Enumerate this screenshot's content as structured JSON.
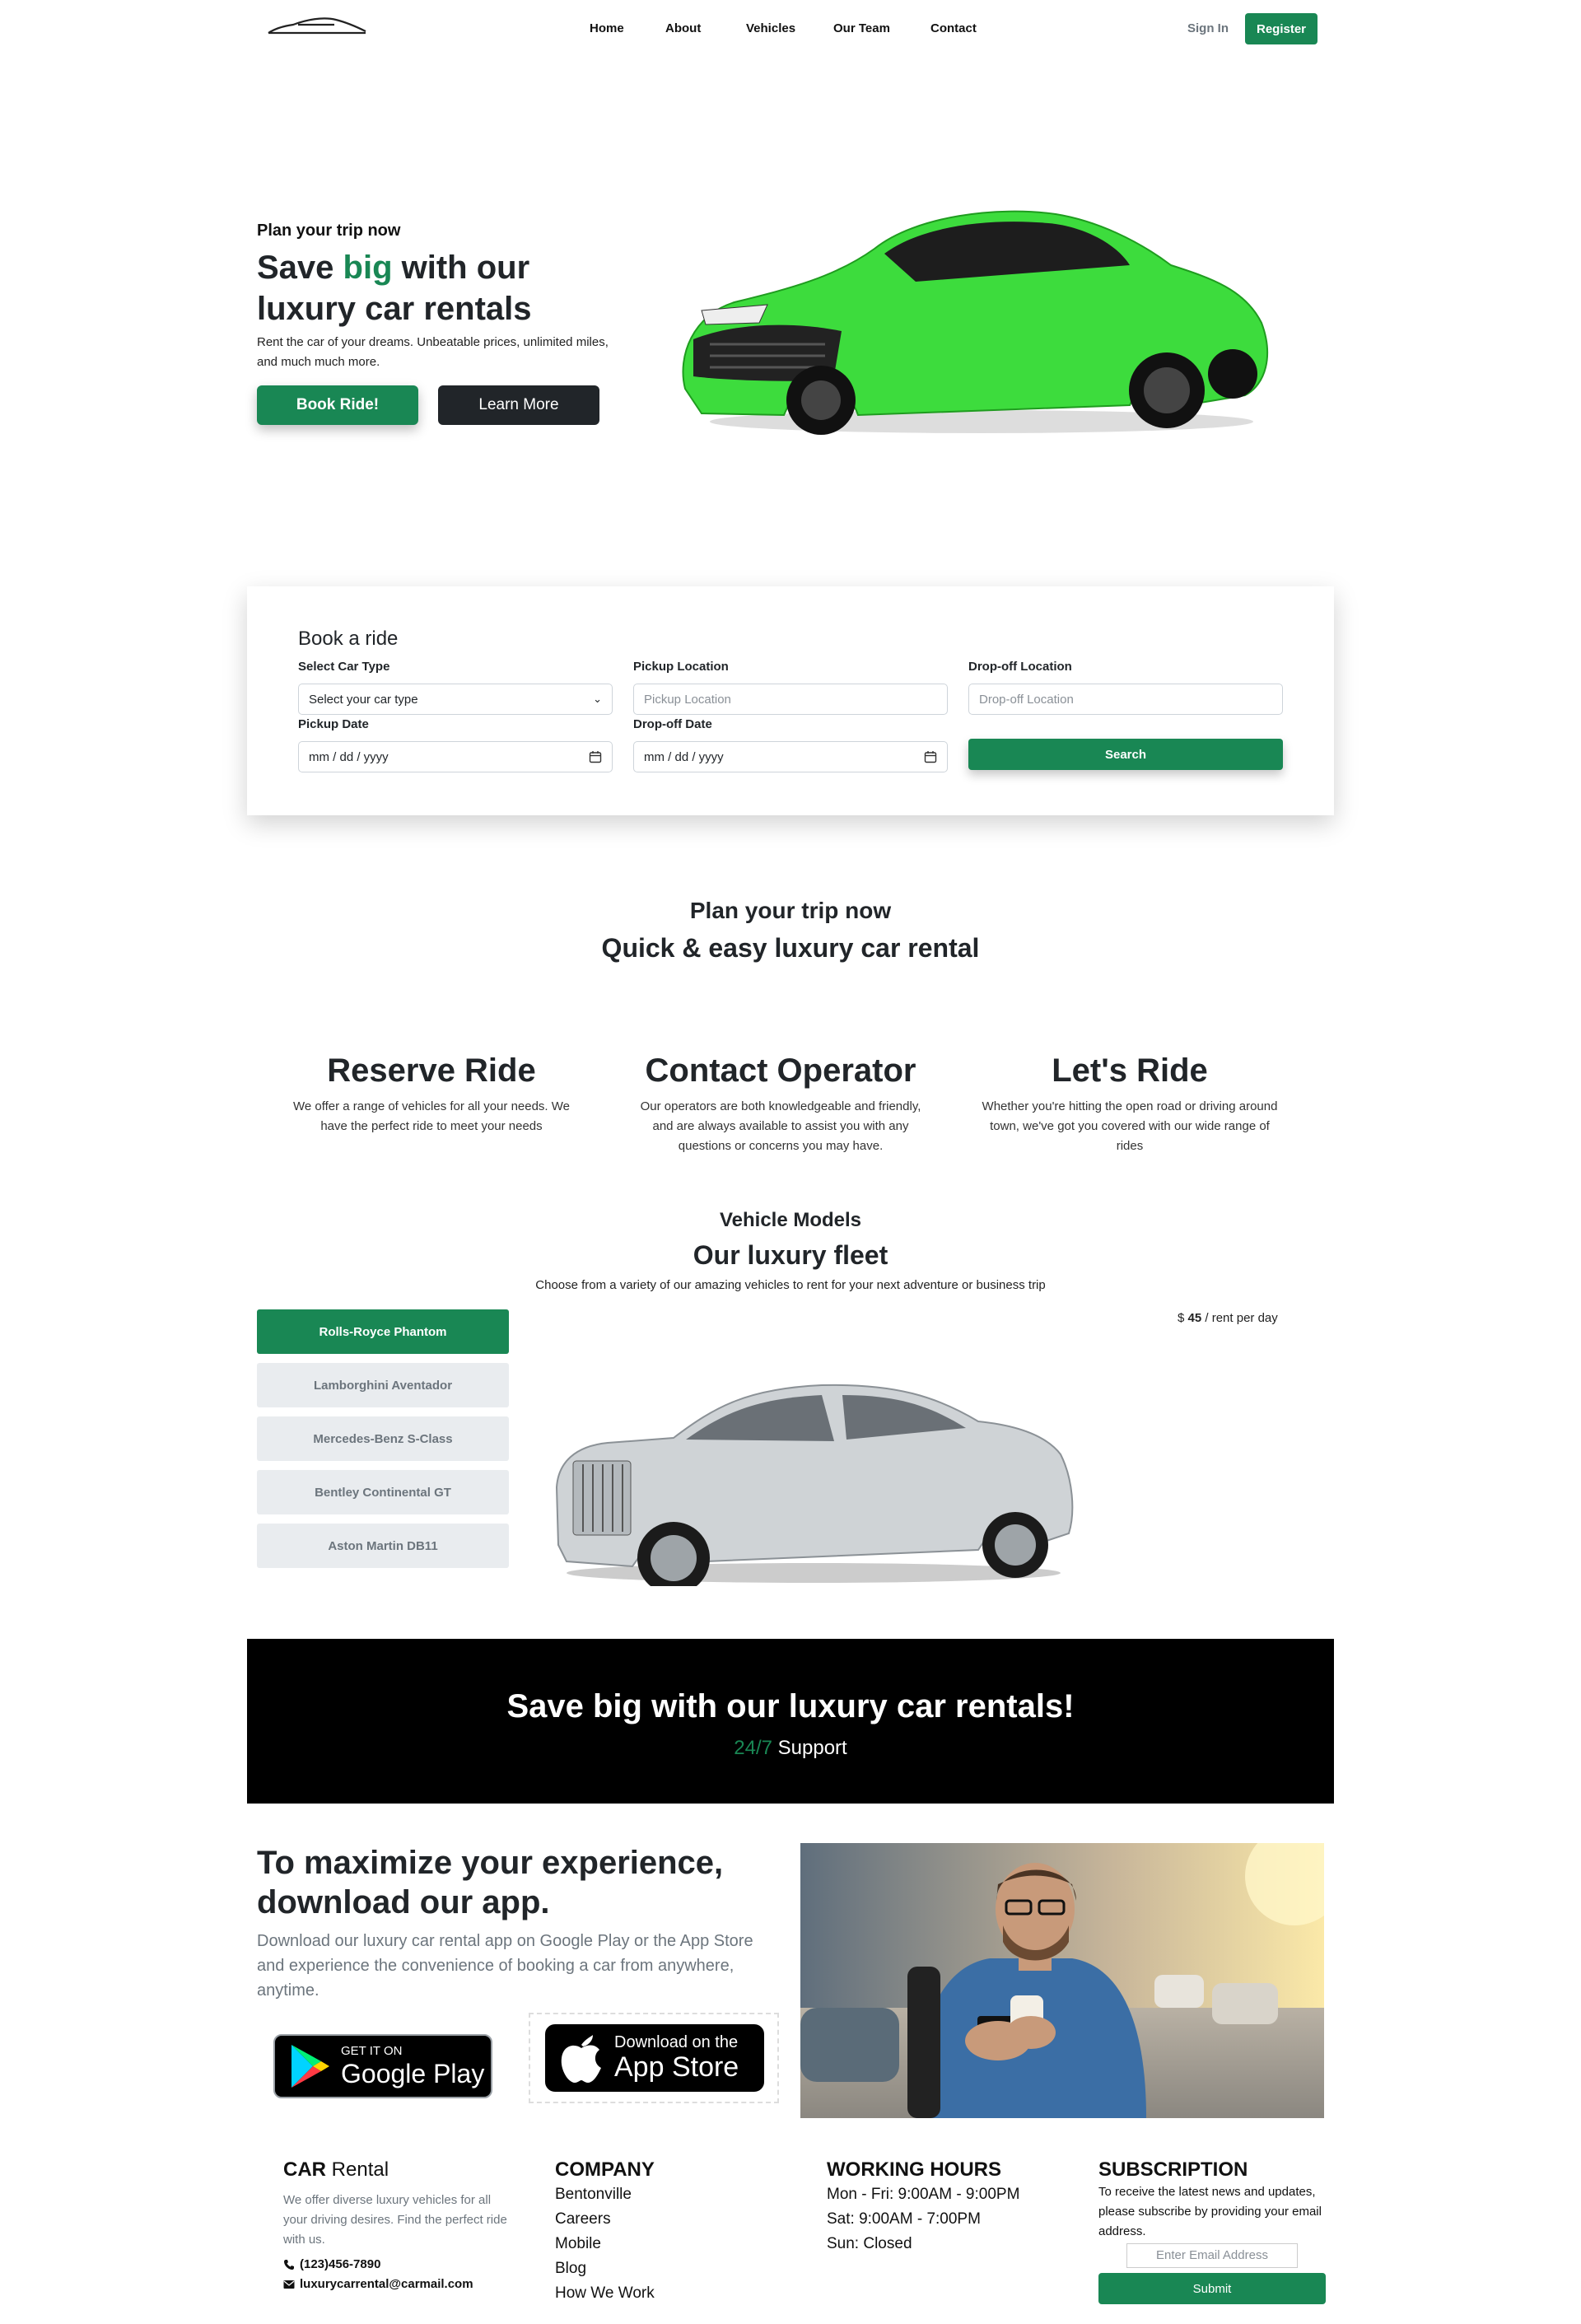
{
  "nav": {
    "links": [
      "Home",
      "About",
      "Vehicles",
      "Our Team",
      "Contact"
    ],
    "sign_in": "Sign In",
    "register": "Register"
  },
  "hero": {
    "subtitle": "Plan your trip now",
    "title_pre": "Save ",
    "title_highlight": "big",
    "title_post": " with our luxury car rentals",
    "description": "Rent the car of your dreams. Unbeatable prices, unlimited miles, and much much more.",
    "book_button": "Book Ride!",
    "learn_button": "Learn More"
  },
  "booking": {
    "title": "Book a ride",
    "car_type_label": "Select Car Type",
    "car_type_value": "Select your car type",
    "pickup_location_label": "Pickup Location",
    "pickup_location_placeholder": "Pickup Location",
    "dropoff_location_label": "Drop-off Location",
    "dropoff_location_placeholder": "Drop-off Location",
    "pickup_date_label": "Pickup Date",
    "pickup_date_value": "mm / dd / yyyy",
    "dropoff_date_label": "Drop-off Date",
    "dropoff_date_value": "mm / dd / yyyy",
    "search_button": "Search"
  },
  "plan": {
    "subtitle": "Plan your trip now",
    "title": "Quick & easy luxury car rental"
  },
  "features": [
    {
      "title": "Reserve Ride",
      "text": "We offer a range of vehicles for all your needs. We have the perfect ride to meet your needs"
    },
    {
      "title": "Contact Operator",
      "text": "Our operators are both knowledgeable and friendly, and are always available to assist you with any questions or concerns you may have."
    },
    {
      "title": "Let's Ride",
      "text": "Whether you're hitting the open road or driving around town, we've got you covered with our wide range of rides"
    }
  ],
  "fleet": {
    "subtitle": "Vehicle Models",
    "title": "Our luxury fleet",
    "description": "Choose from a variety of our amazing vehicles to rent for your next adventure or business trip",
    "models": [
      "Rolls-Royce Phantom",
      "Lamborghini Aventador",
      "Mercedes-Benz S-Class",
      "Bentley Continental GT",
      "Aston Martin DB11"
    ],
    "price_currency": "$",
    "price_value": "45",
    "price_suffix": "/ rent per day"
  },
  "banner": {
    "title": "Save big with our luxury car rentals!",
    "support_highlight": "24/7",
    "support_text": " Support"
  },
  "app": {
    "title": "To maximize your experience, download our app.",
    "description": "Download our luxury car rental app on Google Play or the App Store and experience the convenience of booking a car from anywhere, anytime.",
    "google_small": "GET IT ON",
    "google_big": "Google Play",
    "apple_small": "Download on the",
    "apple_big": "App Store"
  },
  "footer": {
    "brand_bold": "CAR",
    "brand_rest": " Rental",
    "about": "We offer diverse luxury vehicles for all your driving desires. Find the perfect ride with us.",
    "phone": "(123)456-7890",
    "email": "luxurycarrental@carmail.com",
    "company_title": "COMPANY",
    "company_links": [
      "Bentonville",
      "Careers",
      "Mobile",
      "Blog",
      "How We Work"
    ],
    "hours_title": "WORKING HOURS",
    "hours": [
      "Mon - Fri: 9:00AM - 9:00PM",
      "Sat: 9:00AM - 7:00PM",
      "Sun: Closed"
    ],
    "subscription_title": "SUBSCRIPTION",
    "subscription_text": "To receive the latest news and updates, please subscribe by providing your email address.",
    "email_placeholder": "Enter Email Address",
    "submit": "Submit"
  },
  "colors": {
    "accent": "#198754",
    "dark": "#212529",
    "banner": "#000000",
    "hero_car": "#3ddc3d"
  }
}
